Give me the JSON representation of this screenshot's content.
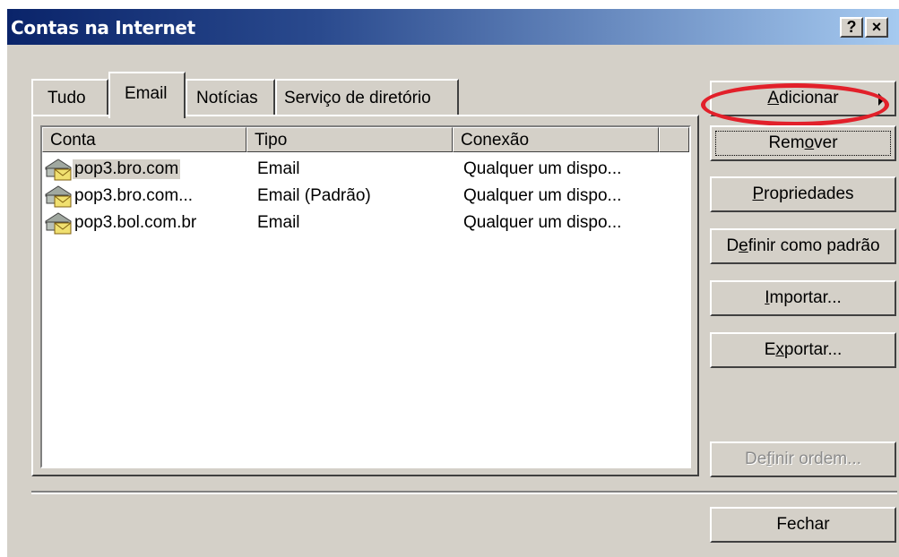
{
  "window": {
    "title": "Contas na Internet",
    "help_label": "?",
    "close_label": "×"
  },
  "tabs": [
    {
      "label": "Tudo",
      "active": false
    },
    {
      "label": "Email",
      "active": true
    },
    {
      "label": "Notícias",
      "active": false
    },
    {
      "label": "Serviço de diretório",
      "active": false
    }
  ],
  "list": {
    "columns": [
      "Conta",
      "Tipo",
      "Conexão"
    ],
    "rows": [
      {
        "account": "pop3.bro.com",
        "type": "Email",
        "connection": "Qualquer um dispo...",
        "selected": true,
        "icon": "mail-account-icon"
      },
      {
        "account": "pop3.bro.com...",
        "type": "Email (Padrão)",
        "connection": "Qualquer um dispo...",
        "selected": false,
        "icon": "mail-account-icon"
      },
      {
        "account": "pop3.bol.com.br",
        "type": "Email",
        "connection": "Qualquer um dispo...",
        "selected": false,
        "icon": "mail-account-icon"
      }
    ]
  },
  "buttons": {
    "add": {
      "pre": "",
      "mn": "A",
      "post": "dicionar"
    },
    "remove": {
      "pre": "Rem",
      "mn": "o",
      "post": "ver"
    },
    "properties": {
      "pre": "",
      "mn": "P",
      "post": "ropriedades"
    },
    "set_default": {
      "pre": "D",
      "mn": "e",
      "post": "finir como padrão"
    },
    "import": {
      "pre": "",
      "mn": "I",
      "post": "mportar..."
    },
    "export": {
      "pre": "E",
      "mn": "x",
      "post": "portar..."
    },
    "set_order": {
      "pre": "De",
      "mn": "f",
      "post": "inir ordem..."
    },
    "close": {
      "pre": "Fechar",
      "mn": "",
      "post": ""
    }
  },
  "colors": {
    "highlight_circle": "#e2202a",
    "face": "#d4d0c8",
    "titlebar_start": "#0a246a"
  }
}
